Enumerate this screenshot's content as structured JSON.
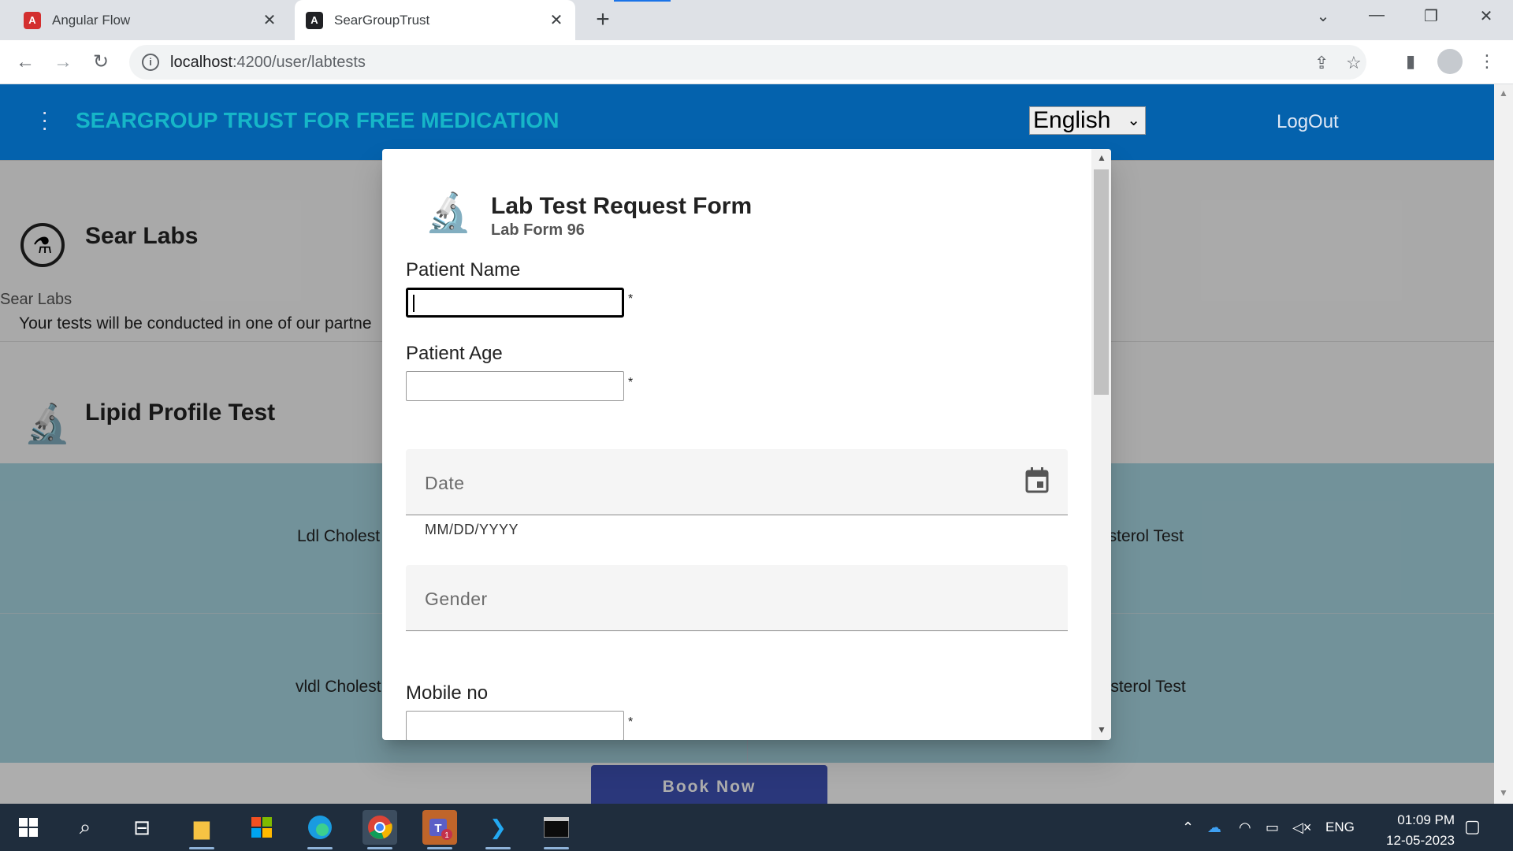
{
  "browser": {
    "tabs": [
      {
        "title": "Angular Flow",
        "favicon": "angular-flow-icon",
        "favicon_color": "#d32f2f"
      },
      {
        "title": "SearGroupTrust",
        "favicon": "angular-icon",
        "favicon_color": "#202124"
      }
    ],
    "url_host": "localhost",
    "url_path": ":4200/user/labtests"
  },
  "app": {
    "brand": "SEARGROUP TRUST FOR FREE MEDICATION",
    "language": "English",
    "logout": "LogOut",
    "colors": {
      "appbar": "#0462ad",
      "brand": "#16b6c8",
      "teal": "#a9d7e3",
      "book": "#3f51b5"
    }
  },
  "background": {
    "lab_name": "Sear Labs",
    "lab_sub": "Sear Labs",
    "lab_desc": "Your tests will be conducted in one of our partne",
    "test_name": "Lipid Profile Test",
    "cells": [
      "Ldl Cholest",
      "esterol Test",
      "vldl Cholest",
      "lesterol Test"
    ],
    "book_now": "Book Now"
  },
  "dialog": {
    "title": "Lab Test Request Form",
    "subtitle": "Lab Form 96",
    "patient_name_label": "Patient Name",
    "patient_age_label": "Patient Age",
    "required_mark": "*",
    "date_placeholder": "Date",
    "date_hint": "MM/DD/YYYY",
    "gender_placeholder": "Gender",
    "mobile_label": "Mobile no"
  },
  "taskbar": {
    "tray_lang": "ENG",
    "time": "01:09 PM",
    "date": "12-05-2023",
    "teams_badge": "1"
  }
}
